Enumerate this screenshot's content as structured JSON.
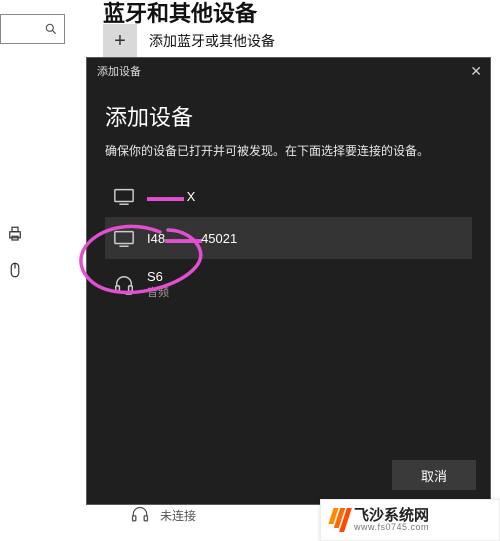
{
  "page": {
    "title_fragment": "蓝牙和其他设备",
    "add_label": "添加蓝牙或其他设备",
    "bottom_status": "未连接"
  },
  "search": {
    "placeholder": ""
  },
  "modal": {
    "titlebar": "添加设备",
    "heading": "添加设备",
    "subtext": "确保你的设备已打开并可被发现。在下面选择要连接的设备。",
    "cancel": "取消",
    "devices": [
      {
        "name_prefix": "",
        "name_suffix": " X",
        "redacted": true,
        "icon": "display",
        "sub": ""
      },
      {
        "name_prefix": "I48",
        "name_suffix": "45021",
        "redacted": true,
        "icon": "display",
        "sub": "",
        "highlight": true
      },
      {
        "name": "S6",
        "icon": "headset",
        "sub": "音频"
      }
    ]
  },
  "watermark": {
    "main": "飞沙系统网",
    "sub": "www.fs0745.com"
  }
}
